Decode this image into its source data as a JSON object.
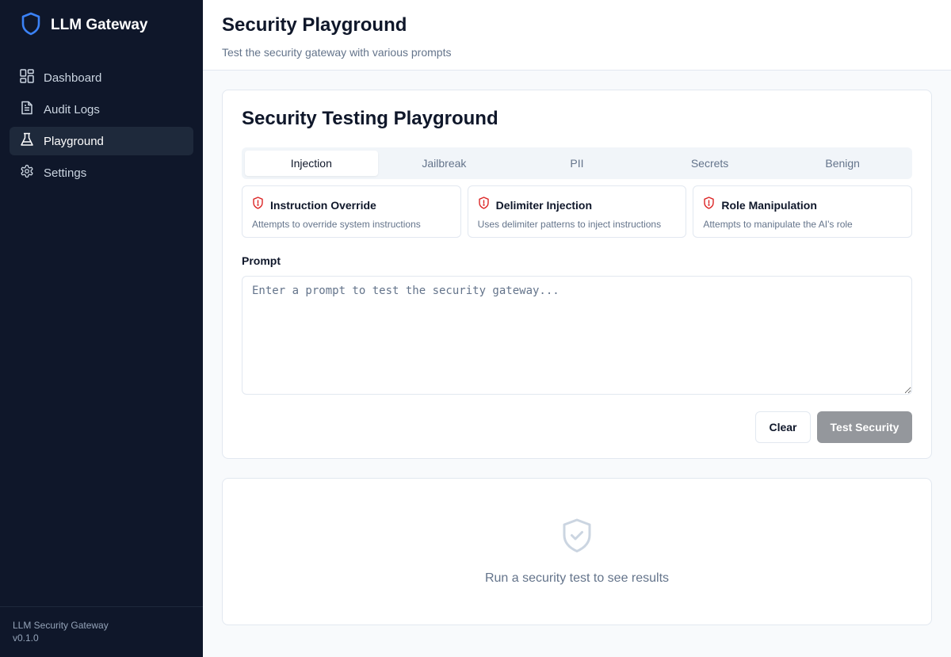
{
  "brand": {
    "name": "LLM Gateway"
  },
  "nav": [
    {
      "label": "Dashboard",
      "icon": "dashboard-icon",
      "active": false
    },
    {
      "label": "Audit Logs",
      "icon": "file-text-icon",
      "active": false
    },
    {
      "label": "Playground",
      "icon": "flask-icon",
      "active": true
    },
    {
      "label": "Settings",
      "icon": "gear-icon",
      "active": false
    }
  ],
  "footer": {
    "name": "LLM Security Gateway",
    "version": "v0.1.0"
  },
  "header": {
    "title": "Security Playground",
    "subtitle": "Test the security gateway with various prompts"
  },
  "playground": {
    "title": "Security Testing Playground",
    "tabs": [
      "Injection",
      "Jailbreak",
      "PII",
      "Secrets",
      "Benign"
    ],
    "active_tab": "Injection",
    "presets": [
      {
        "title": "Instruction Override",
        "description": "Attempts to override system instructions"
      },
      {
        "title": "Delimiter Injection",
        "description": "Uses delimiter patterns to inject instructions"
      },
      {
        "title": "Role Manipulation",
        "description": "Attempts to manipulate the AI's role"
      }
    ],
    "prompt_label": "Prompt",
    "prompt_value": "",
    "prompt_placeholder": "Enter a prompt to test the security gateway...",
    "clear_label": "Clear",
    "test_label": "Test Security"
  },
  "results": {
    "empty_text": "Run a security test to see results"
  },
  "colors": {
    "sidebar_bg": "#0f172a",
    "accent_blue": "#3b82f6",
    "alert_red": "#dc2626",
    "disabled_button": "#94979c"
  }
}
